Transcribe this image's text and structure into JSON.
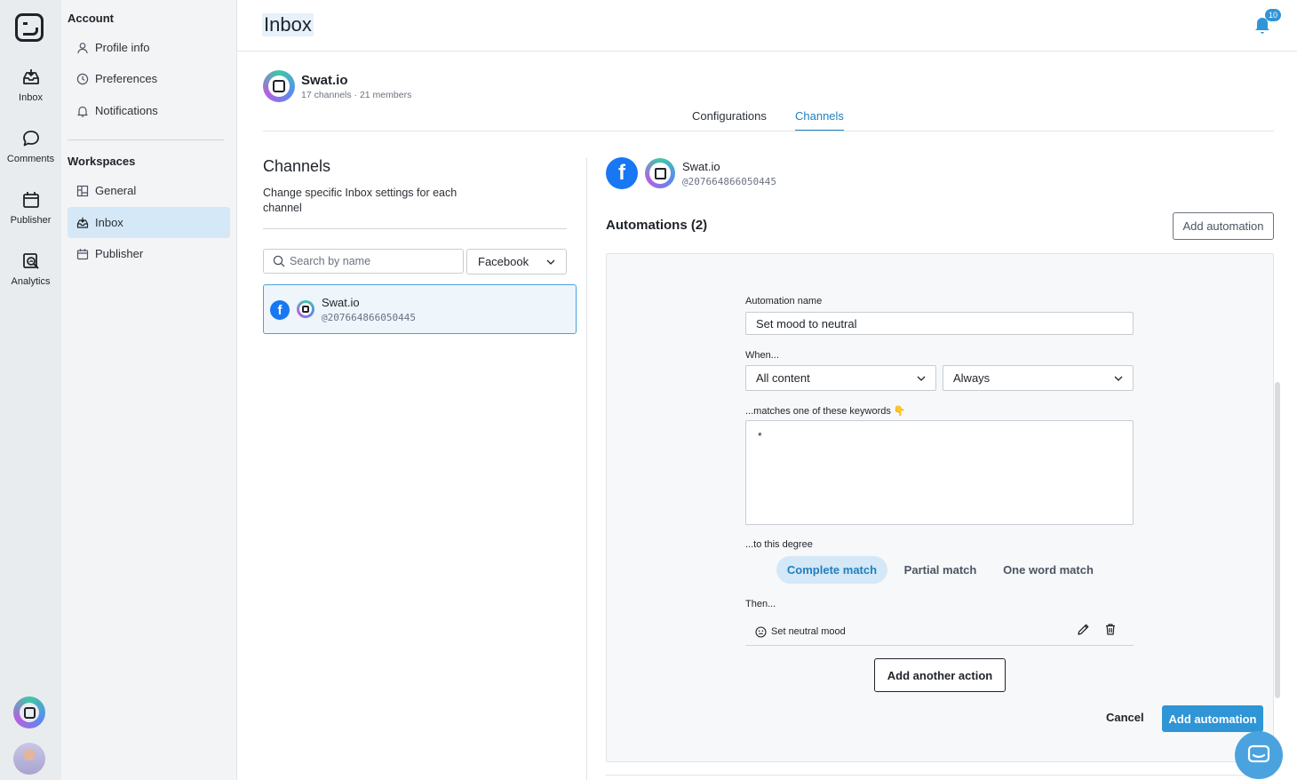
{
  "rail": {
    "items": [
      {
        "label": "Inbox",
        "icon": "inbox-icon"
      },
      {
        "label": "Comments",
        "icon": "comments-icon"
      },
      {
        "label": "Publisher",
        "icon": "calendar-icon"
      },
      {
        "label": "Analytics",
        "icon": "analytics-icon"
      }
    ]
  },
  "nav": {
    "account_heading": "Account",
    "account_items": [
      {
        "label": "Profile info",
        "icon": "user-icon"
      },
      {
        "label": "Preferences",
        "icon": "clock-icon"
      },
      {
        "label": "Notifications",
        "icon": "bell-icon"
      }
    ],
    "workspaces_heading": "Workspaces",
    "workspace_items": [
      {
        "label": "General",
        "icon": "grid-icon"
      },
      {
        "label": "Inbox",
        "icon": "inbox-icon",
        "active": true
      },
      {
        "label": "Publisher",
        "icon": "calendar-icon"
      }
    ]
  },
  "header": {
    "title": "Inbox",
    "notification_count": "10"
  },
  "workspace": {
    "name": "Swat.io",
    "meta": "17 channels · 21 members"
  },
  "tabs": [
    {
      "label": "Configurations"
    },
    {
      "label": "Channels",
      "active": true
    }
  ],
  "channels": {
    "title": "Channels",
    "description": "Change specific Inbox settings for each channel",
    "search_placeholder": "Search by name",
    "filter_value": "Facebook",
    "list": [
      {
        "name": "Swat.io",
        "id": "@207664866050445",
        "network": "Facebook"
      }
    ]
  },
  "detail": {
    "channel_name": "Swat.io",
    "channel_id": "@207664866050445",
    "automations_title": "Automations (2)",
    "add_automation_label": "Add automation",
    "form": {
      "name_label": "Automation name",
      "name_value": "Set mood to neutral",
      "when_label": "When...",
      "content_select": "All content",
      "timing_select": "Always",
      "keywords_label": "...matches one of these keywords 👇",
      "keywords_value": "*",
      "degree_label": "...to this degree",
      "degree_options": [
        "Complete match",
        "Partial match",
        "One word match"
      ],
      "degree_selected": "Complete match",
      "then_label": "Then...",
      "action": "Set neutral mood",
      "add_action_label": "Add another action",
      "cancel_label": "Cancel",
      "submit_label": "Add automation"
    }
  },
  "colors": {
    "accent": "#2f95d6",
    "active_tint": "#d4e8f7",
    "facebook": "#1877f2"
  }
}
